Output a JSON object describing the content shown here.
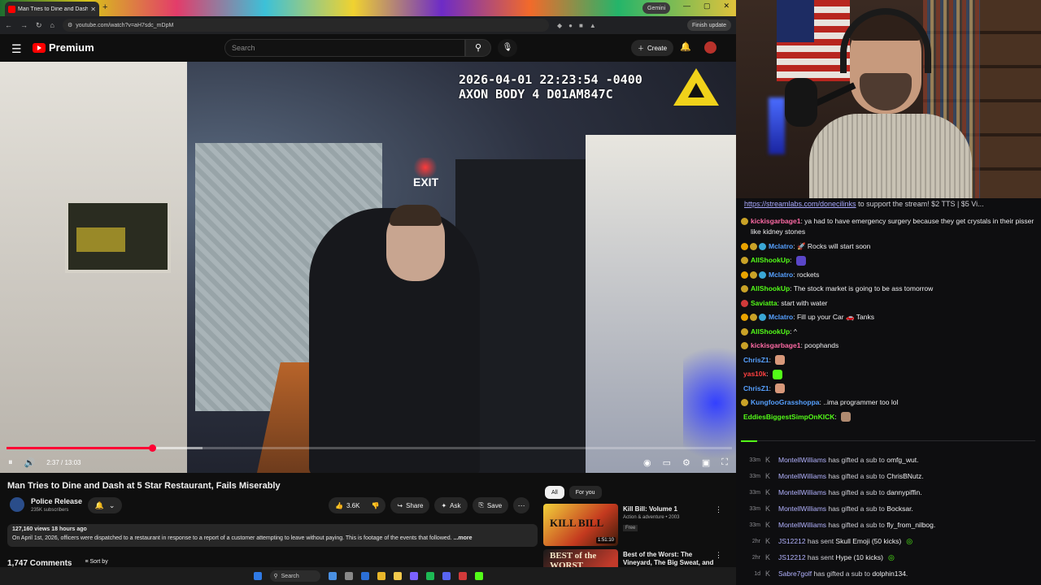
{
  "browser": {
    "tab_title": "Man Tries to Dine and Dash",
    "new_tab": "+",
    "gemini": "Gemini",
    "url": "youtube.com/watch?v=aH7sdc_mDpM",
    "finish_update": "Finish update",
    "window_controls": [
      "—",
      "▢",
      "✕"
    ]
  },
  "youtube": {
    "brand": "Premium",
    "search_placeholder": "Search",
    "create": "Create",
    "video": {
      "osd_line1": "2026-04-01 22:23:54 -0400",
      "osd_line2": "AXON BODY 4 D01AM847C",
      "exit_sign": "EXIT",
      "time": "2:37 / 13:03",
      "progress": 0.201,
      "buffered": 0.27
    },
    "title": "Man Tries to Dine and Dash at 5 Star Restaurant, Fails Miserably",
    "channel": {
      "name": "Police Release",
      "subs": "235K subscribers"
    },
    "actions": {
      "likes": "3.6K",
      "share": "Share",
      "ask": "Ask",
      "save": "Save"
    },
    "description": {
      "meta": "127,160 views  18 hours ago",
      "text": "On April 1st, 2026, officers were dispatched to a restaurant in response to a report of a customer attempting to leave without paying. This is footage of the events that followed.",
      "more": "...more"
    },
    "comments": {
      "count": "1,747 Comments",
      "sort": "Sort by"
    },
    "filters": [
      "All",
      "For you"
    ],
    "recommendations": [
      {
        "title": "Kill Bill: Volume 1",
        "sub": "Action & adventure • 2003",
        "badge": "Free",
        "duration": "1:51:10",
        "thumb_text": "KILL BILL"
      },
      {
        "title": "Best of the Worst: The Vineyard, The Big Sweat, and Scarlet",
        "sub": "",
        "badge": "",
        "duration": "",
        "thumb_text": "BEST of the WORST"
      }
    ]
  },
  "taskbar": {
    "search": "Search"
  },
  "chat": {
    "top_link": "https://streamlabs.com/donecilinks",
    "top_text": " to support the stream! $2 TTS | $5 Vi...",
    "messages": [
      {
        "user": "kickisgarbage1",
        "color": "#ff6aa5",
        "text": "ya had to have emergency surgery because they get crystals in their pisser like kidney stones",
        "badges": [
          "#c9a227"
        ]
      },
      {
        "user": "Mclatro",
        "color": "#56a0ff",
        "text": "🚀 Rocks will start soon",
        "badges": [
          "#e9a300",
          "#c9a227",
          "#3aa7d6"
        ]
      },
      {
        "user": "AllShookUp",
        "color": "#53fc18",
        "text": "",
        "badges": [
          "#c9a227"
        ],
        "emote": "#5a46c8"
      },
      {
        "user": "Mclatro",
        "color": "#56a0ff",
        "text": "rockets",
        "badges": [
          "#e9a300",
          "#c9a227",
          "#3aa7d6"
        ]
      },
      {
        "user": "AllShookUp",
        "color": "#53fc18",
        "text": "The stock market is going to be ass tomorrow",
        "badges": [
          "#c9a227"
        ]
      },
      {
        "user": "Saviatta",
        "color": "#53fc18",
        "text": "start with water",
        "badges": [
          "#d13a3a"
        ]
      },
      {
        "user": "Mclatro",
        "color": "#56a0ff",
        "text": "Fill up your Car 🚗 Tanks",
        "badges": [
          "#e9a300",
          "#c9a227",
          "#3aa7d6"
        ]
      },
      {
        "user": "AllShookUp",
        "color": "#53fc18",
        "text": "^",
        "badges": [
          "#c9a227"
        ]
      },
      {
        "user": "kickisgarbage1",
        "color": "#ff6aa5",
        "text": "poophands",
        "badges": [
          "#c9a227"
        ]
      },
      {
        "user": "ChrisZ1",
        "color": "#56a0ff",
        "text": "",
        "badges": [],
        "emote": "#d8987a"
      },
      {
        "user": "yas10k",
        "color": "#ff4040",
        "text": "",
        "badges": [],
        "emote": "#53fc18"
      },
      {
        "user": "ChrisZ1",
        "color": "#56a0ff",
        "text": "",
        "badges": [],
        "emote": "#d8987a"
      },
      {
        "user": "KungfooGrasshoppa",
        "color": "#56a0ff",
        "text": "..ima programmer too lol",
        "badges": [
          "#c9a227"
        ]
      },
      {
        "user": "EddiesBiggestSimpOnKICK",
        "color": "#53fc18",
        "text": "",
        "badges": [],
        "emote": "#b08a70"
      }
    ],
    "events": [
      {
        "ago": "33m",
        "who": "MontellWilliams",
        "text": " has gifted a sub to ",
        "target": "omfg_wut.",
        "tag": ""
      },
      {
        "ago": "33m",
        "who": "MontellWilliams",
        "text": " has gifted a sub to ",
        "target": "ChrisBNutz.",
        "tag": ""
      },
      {
        "ago": "33m",
        "who": "MontellWilliams",
        "text": " has gifted a sub to ",
        "target": "dannypiffin.",
        "tag": ""
      },
      {
        "ago": "33m",
        "who": "MontellWilliams",
        "text": " has gifted a sub to ",
        "target": "Bocksar.",
        "tag": ""
      },
      {
        "ago": "33m",
        "who": "MontellWilliams",
        "text": " has gifted a sub to ",
        "target": "fly_from_nilbog.",
        "tag": ""
      },
      {
        "ago": "2hr",
        "who": "JS12212",
        "text": " has sent ",
        "target": "Skull Emoji (50 kicks)",
        "tag": "◎"
      },
      {
        "ago": "2hr",
        "who": "JS12212",
        "text": " has sent ",
        "target": "Hype (10 kicks)",
        "tag": "◎"
      },
      {
        "ago": "1d",
        "who": "Sabre7golf",
        "text": " has gifted a sub to ",
        "target": "dolphin134.",
        "tag": ""
      }
    ]
  },
  "colors": {
    "accent_red": "#ff0033",
    "kick_green": "#53fc18",
    "yt_bg": "#0f0f0f"
  }
}
